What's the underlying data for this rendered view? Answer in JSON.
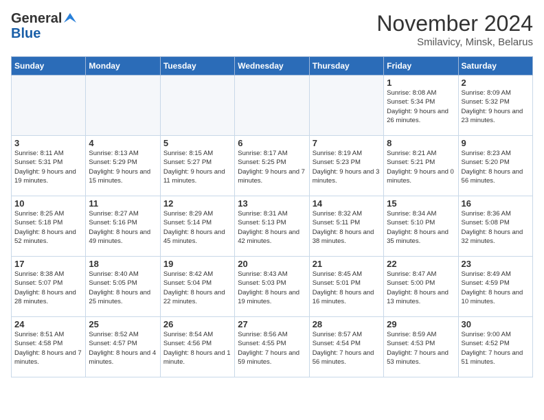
{
  "header": {
    "logo_general": "General",
    "logo_blue": "Blue",
    "month_title": "November 2024",
    "location": "Smilavicy, Minsk, Belarus"
  },
  "days_of_week": [
    "Sunday",
    "Monday",
    "Tuesday",
    "Wednesday",
    "Thursday",
    "Friday",
    "Saturday"
  ],
  "weeks": [
    [
      {
        "day": "",
        "info": ""
      },
      {
        "day": "",
        "info": ""
      },
      {
        "day": "",
        "info": ""
      },
      {
        "day": "",
        "info": ""
      },
      {
        "day": "",
        "info": ""
      },
      {
        "day": "1",
        "info": "Sunrise: 8:08 AM\nSunset: 5:34 PM\nDaylight: 9 hours and 26 minutes."
      },
      {
        "day": "2",
        "info": "Sunrise: 8:09 AM\nSunset: 5:32 PM\nDaylight: 9 hours and 23 minutes."
      }
    ],
    [
      {
        "day": "3",
        "info": "Sunrise: 8:11 AM\nSunset: 5:31 PM\nDaylight: 9 hours and 19 minutes."
      },
      {
        "day": "4",
        "info": "Sunrise: 8:13 AM\nSunset: 5:29 PM\nDaylight: 9 hours and 15 minutes."
      },
      {
        "day": "5",
        "info": "Sunrise: 8:15 AM\nSunset: 5:27 PM\nDaylight: 9 hours and 11 minutes."
      },
      {
        "day": "6",
        "info": "Sunrise: 8:17 AM\nSunset: 5:25 PM\nDaylight: 9 hours and 7 minutes."
      },
      {
        "day": "7",
        "info": "Sunrise: 8:19 AM\nSunset: 5:23 PM\nDaylight: 9 hours and 3 minutes."
      },
      {
        "day": "8",
        "info": "Sunrise: 8:21 AM\nSunset: 5:21 PM\nDaylight: 9 hours and 0 minutes."
      },
      {
        "day": "9",
        "info": "Sunrise: 8:23 AM\nSunset: 5:20 PM\nDaylight: 8 hours and 56 minutes."
      }
    ],
    [
      {
        "day": "10",
        "info": "Sunrise: 8:25 AM\nSunset: 5:18 PM\nDaylight: 8 hours and 52 minutes."
      },
      {
        "day": "11",
        "info": "Sunrise: 8:27 AM\nSunset: 5:16 PM\nDaylight: 8 hours and 49 minutes."
      },
      {
        "day": "12",
        "info": "Sunrise: 8:29 AM\nSunset: 5:14 PM\nDaylight: 8 hours and 45 minutes."
      },
      {
        "day": "13",
        "info": "Sunrise: 8:31 AM\nSunset: 5:13 PM\nDaylight: 8 hours and 42 minutes."
      },
      {
        "day": "14",
        "info": "Sunrise: 8:32 AM\nSunset: 5:11 PM\nDaylight: 8 hours and 38 minutes."
      },
      {
        "day": "15",
        "info": "Sunrise: 8:34 AM\nSunset: 5:10 PM\nDaylight: 8 hours and 35 minutes."
      },
      {
        "day": "16",
        "info": "Sunrise: 8:36 AM\nSunset: 5:08 PM\nDaylight: 8 hours and 32 minutes."
      }
    ],
    [
      {
        "day": "17",
        "info": "Sunrise: 8:38 AM\nSunset: 5:07 PM\nDaylight: 8 hours and 28 minutes."
      },
      {
        "day": "18",
        "info": "Sunrise: 8:40 AM\nSunset: 5:05 PM\nDaylight: 8 hours and 25 minutes."
      },
      {
        "day": "19",
        "info": "Sunrise: 8:42 AM\nSunset: 5:04 PM\nDaylight: 8 hours and 22 minutes."
      },
      {
        "day": "20",
        "info": "Sunrise: 8:43 AM\nSunset: 5:03 PM\nDaylight: 8 hours and 19 minutes."
      },
      {
        "day": "21",
        "info": "Sunrise: 8:45 AM\nSunset: 5:01 PM\nDaylight: 8 hours and 16 minutes."
      },
      {
        "day": "22",
        "info": "Sunrise: 8:47 AM\nSunset: 5:00 PM\nDaylight: 8 hours and 13 minutes."
      },
      {
        "day": "23",
        "info": "Sunrise: 8:49 AM\nSunset: 4:59 PM\nDaylight: 8 hours and 10 minutes."
      }
    ],
    [
      {
        "day": "24",
        "info": "Sunrise: 8:51 AM\nSunset: 4:58 PM\nDaylight: 8 hours and 7 minutes."
      },
      {
        "day": "25",
        "info": "Sunrise: 8:52 AM\nSunset: 4:57 PM\nDaylight: 8 hours and 4 minutes."
      },
      {
        "day": "26",
        "info": "Sunrise: 8:54 AM\nSunset: 4:56 PM\nDaylight: 8 hours and 1 minute."
      },
      {
        "day": "27",
        "info": "Sunrise: 8:56 AM\nSunset: 4:55 PM\nDaylight: 7 hours and 59 minutes."
      },
      {
        "day": "28",
        "info": "Sunrise: 8:57 AM\nSunset: 4:54 PM\nDaylight: 7 hours and 56 minutes."
      },
      {
        "day": "29",
        "info": "Sunrise: 8:59 AM\nSunset: 4:53 PM\nDaylight: 7 hours and 53 minutes."
      },
      {
        "day": "30",
        "info": "Sunrise: 9:00 AM\nSunset: 4:52 PM\nDaylight: 7 hours and 51 minutes."
      }
    ]
  ]
}
